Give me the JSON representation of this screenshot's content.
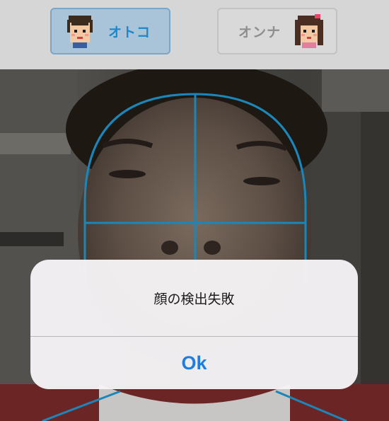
{
  "gender_selector": {
    "male": {
      "label": "オトコ",
      "icon": "boy-avatar-icon",
      "selected": true,
      "accent_color": "#1f86c9"
    },
    "female": {
      "label": "オンナ",
      "icon": "girl-avatar-icon",
      "selected": false,
      "accent_color": "#8e8e8e"
    }
  },
  "camera": {
    "guide_overlay": "face-guide-outline",
    "guide_color": "#1b86b8"
  },
  "alert": {
    "message": "顔の検出失敗",
    "ok_label": "Ok",
    "ok_color": "#1e7de0"
  }
}
